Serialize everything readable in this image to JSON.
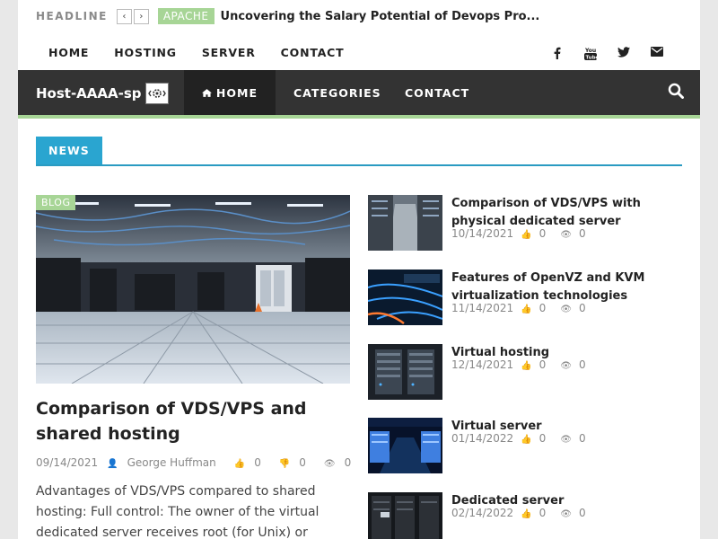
{
  "ticker": {
    "label": "HEADLINE",
    "prev": "‹",
    "next": "›",
    "category": "APACHE",
    "title": "Uncovering the Salary Potential of Devops Pro..."
  },
  "topnav": [
    "HOME",
    "HOSTING",
    "SERVER",
    "CONTACT"
  ],
  "social_icons": [
    "facebook-icon",
    "youtube-icon",
    "twitter-icon",
    "envelope-icon"
  ],
  "mainnav": {
    "logo": "Host-AAAA-sp",
    "home": "HOME",
    "categories": "CATEGORIES",
    "contact": "CONTACT"
  },
  "section": {
    "title": "NEWS"
  },
  "featured": {
    "category": "BLOG",
    "title": "Comparison of VDS/VPS and shared hosting",
    "date": "09/14/2021",
    "author": "George Huffman",
    "likes": "0",
    "dislikes": "0",
    "views": "0",
    "excerpt": "Advantages of VDS/VPS compared to shared hosting: Full control: The owner of the virtual dedicated server receives root (for Unix) or Administrator (for"
  },
  "list": [
    {
      "title": "Comparison of VDS/VPS with physical dedicated server",
      "date": "10/14/2021",
      "likes": "0",
      "views": "0"
    },
    {
      "title": "Features of OpenVZ and KVM virtualization technologies",
      "date": "11/14/2021",
      "likes": "0",
      "views": "0"
    },
    {
      "title": "Virtual hosting",
      "date": "12/14/2021",
      "likes": "0",
      "views": "0"
    },
    {
      "title": "Virtual server",
      "date": "01/14/2022",
      "likes": "0",
      "views": "0"
    },
    {
      "title": "Dedicated server",
      "date": "02/14/2022",
      "likes": "0",
      "views": "0"
    }
  ],
  "colors": {
    "accent_green": "#a7d596",
    "accent_blue": "#2aa5d0",
    "nav_bg": "#333333"
  }
}
